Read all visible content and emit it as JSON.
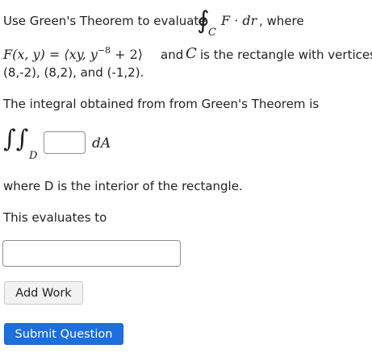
{
  "question": {
    "intro_text": "Use Green's Theorem to evaluate",
    "where_text": ", where",
    "line_integral_integrand": "F · dr",
    "line_integral_contour": "C",
    "field_lhs": "F(x, y) =",
    "field_components_prefix": "⟨xy, y",
    "field_exponent": "−8",
    "field_components_suffix": "+ 2⟩",
    "and_text": "and",
    "curve_symbol": "C",
    "rectangle_text": "is the rectangle with vertices",
    "vertices_text": "(8,-2), (8,2), and (-1,2).",
    "integral_prompt": "The integral obtained from from Green's Theorem is",
    "region_symbol": "D",
    "area_element": "dA",
    "interior_text": "where D is the interior of the rectangle.",
    "evaluates_text": "This evaluates to"
  },
  "inputs": {
    "integrand_value": "",
    "answer_value": ""
  },
  "buttons": {
    "add_work_label": "Add Work",
    "submit_label": "Submit Question"
  },
  "colors": {
    "submit_background": "#1d6fdc",
    "button_background": "#f2f2f2",
    "text": "#222222"
  }
}
